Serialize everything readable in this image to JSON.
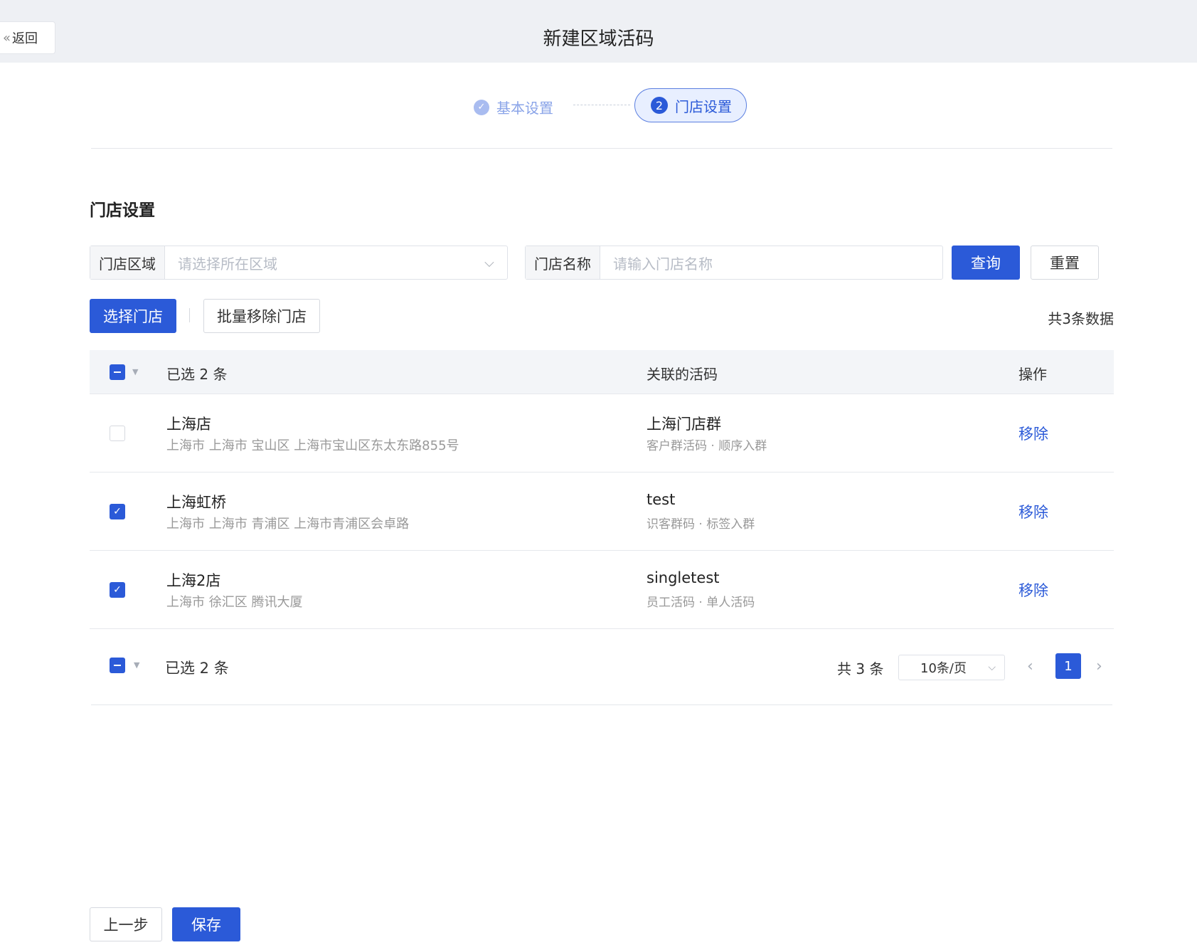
{
  "header": {
    "back_label": "返回",
    "title": "新建区域活码"
  },
  "steps": [
    {
      "label": "基本设置",
      "state": "done"
    },
    {
      "number": "2",
      "label": "门店设置",
      "state": "active"
    }
  ],
  "section": {
    "title": "门店设置"
  },
  "filters": {
    "region": {
      "label": "门店区域",
      "placeholder": "请选择所在区域"
    },
    "name": {
      "label": "门店名称",
      "placeholder": "请输入门店名称"
    },
    "query_label": "查询",
    "reset_label": "重置"
  },
  "toolbar": {
    "select_label": "选择门店",
    "batch_remove_label": "批量移除门店",
    "total_text": "共3条数据"
  },
  "table": {
    "selected_text": "已选 2 条",
    "columns": [
      "关联的活码",
      "操作"
    ],
    "rows": [
      {
        "checked": false,
        "name": "上海店",
        "address": "上海市 上海市 宝山区 上海市宝山区东太东路855号",
        "code": "上海门店群",
        "code_type": "客户群活码 · 顺序入群",
        "action": "移除"
      },
      {
        "checked": true,
        "name": "上海虹桥",
        "address": "上海市 上海市 青浦区 上海市青浦区会卓路",
        "code": "test",
        "code_type": "识客群码 · 标签入群",
        "action": "移除"
      },
      {
        "checked": true,
        "name": "上海2店",
        "address": "上海市 徐汇区 腾讯大厦",
        "code": "singletest",
        "code_type": "员工活码 · 单人活码",
        "action": "移除"
      }
    ]
  },
  "pagination": {
    "selected_text": "已选 2 条",
    "total": "共 3 条",
    "page_size": "10条/页",
    "current_page": "1"
  },
  "bottom": {
    "prev_label": "上一步",
    "save_label": "保存"
  },
  "colors": {
    "primary": "#2b5ad8",
    "header_bg": "#eef0f4"
  }
}
